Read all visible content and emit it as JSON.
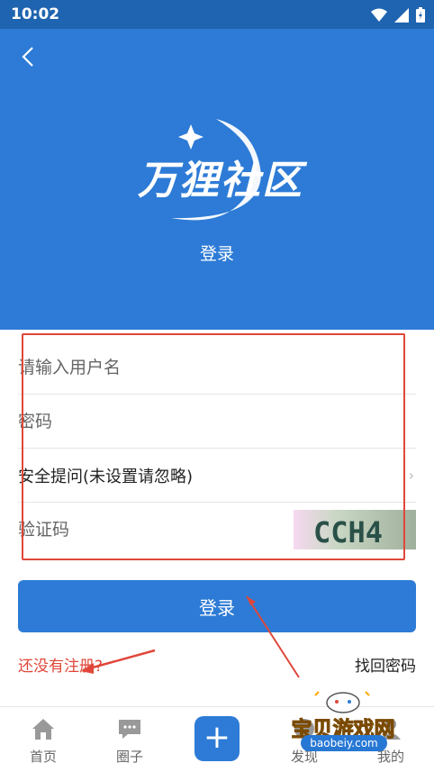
{
  "status_bar": {
    "time": "10:02"
  },
  "header": {
    "back_icon": "chevron-left-icon",
    "logo_text": "万狸社区",
    "title": "登录"
  },
  "form": {
    "username_placeholder": "请输入用户名",
    "password_placeholder": "密码",
    "security_question_label": "安全提问(未设置请忽略)",
    "captcha_placeholder": "验证码",
    "captcha_text": "CCH4"
  },
  "actions": {
    "login_button": "登录",
    "register_link": "还没有注册?",
    "forgot_link": "找回密码"
  },
  "tabbar": {
    "items": [
      {
        "label": "首页",
        "icon": "home-icon"
      },
      {
        "label": "圈子",
        "icon": "chat-icon"
      },
      {
        "label": "",
        "icon": "plus-icon"
      },
      {
        "label": "发现",
        "icon": "discover-icon"
      },
      {
        "label": "我的",
        "icon": "user-icon"
      }
    ]
  },
  "watermark": {
    "text": "宝贝游戏网",
    "domain": "baobeiy.com"
  },
  "colors": {
    "primary": "#2d7bd6",
    "status_bar": "#1f64b0",
    "annotation_red": "#e0473a"
  }
}
